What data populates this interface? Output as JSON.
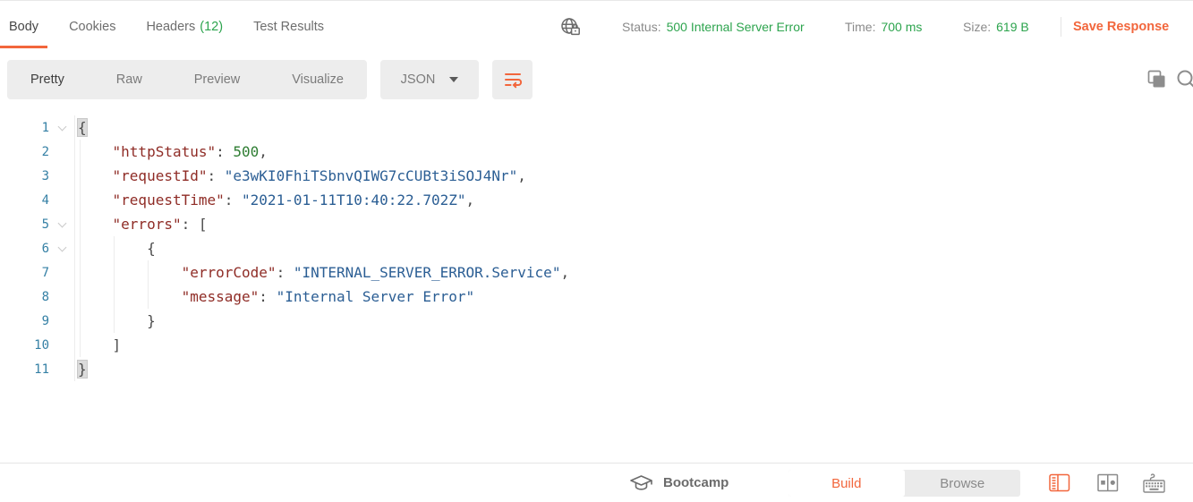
{
  "header": {
    "tabs": [
      {
        "label": "Body",
        "active": true
      },
      {
        "label": "Cookies"
      },
      {
        "label": "Headers",
        "count": "(12)"
      },
      {
        "label": "Test Results"
      }
    ],
    "status_label": "Status:",
    "status_value": "500 Internal Server Error",
    "time_label": "Time:",
    "time_value": "700 ms",
    "size_label": "Size:",
    "size_value": "619 B",
    "save_label": "Save Response"
  },
  "view_bar": {
    "tabs": [
      "Pretty",
      "Raw",
      "Preview",
      "Visualize"
    ],
    "language": "JSON"
  },
  "code": {
    "lines": [
      {
        "n": "1",
        "fold": true,
        "ind": 0,
        "tok": [
          {
            "t": "{",
            "c": "p hl"
          }
        ]
      },
      {
        "n": "2",
        "fold": false,
        "ind": 1,
        "tok": [
          {
            "t": "\"httpStatus\"",
            "c": "k"
          },
          {
            "t": ": ",
            "c": "p"
          },
          {
            "t": "500",
            "c": "n"
          },
          {
            "t": ",",
            "c": "p"
          }
        ]
      },
      {
        "n": "3",
        "fold": false,
        "ind": 1,
        "tok": [
          {
            "t": "\"requestId\"",
            "c": "k"
          },
          {
            "t": ": ",
            "c": "p"
          },
          {
            "t": "\"e3wKI0FhiTSbnvQIWG7cCUBt3iSOJ4Nr\"",
            "c": "s"
          },
          {
            "t": ",",
            "c": "p"
          }
        ]
      },
      {
        "n": "4",
        "fold": false,
        "ind": 1,
        "tok": [
          {
            "t": "\"requestTime\"",
            "c": "k"
          },
          {
            "t": ": ",
            "c": "p"
          },
          {
            "t": "\"2021-01-11T10:40:22.702Z\"",
            "c": "s"
          },
          {
            "t": ",",
            "c": "p"
          }
        ]
      },
      {
        "n": "5",
        "fold": true,
        "ind": 1,
        "tok": [
          {
            "t": "\"errors\"",
            "c": "k"
          },
          {
            "t": ": ",
            "c": "p"
          },
          {
            "t": "[",
            "c": "p"
          }
        ]
      },
      {
        "n": "6",
        "fold": true,
        "ind": 2,
        "tok": [
          {
            "t": "{",
            "c": "p"
          }
        ]
      },
      {
        "n": "7",
        "fold": false,
        "ind": 3,
        "tok": [
          {
            "t": "\"errorCode\"",
            "c": "k"
          },
          {
            "t": ": ",
            "c": "p"
          },
          {
            "t": "\"INTERNAL_SERVER_ERROR.Service\"",
            "c": "s"
          },
          {
            "t": ",",
            "c": "p"
          }
        ]
      },
      {
        "n": "8",
        "fold": false,
        "ind": 3,
        "tok": [
          {
            "t": "\"message\"",
            "c": "k"
          },
          {
            "t": ": ",
            "c": "p"
          },
          {
            "t": "\"Internal Server Error\"",
            "c": "s"
          }
        ]
      },
      {
        "n": "9",
        "fold": false,
        "ind": 2,
        "tok": [
          {
            "t": "}",
            "c": "p"
          }
        ]
      },
      {
        "n": "10",
        "fold": false,
        "ind": 1,
        "tok": [
          {
            "t": "]",
            "c": "p"
          }
        ]
      },
      {
        "n": "11",
        "fold": false,
        "ind": 0,
        "tok": [
          {
            "t": "}",
            "c": "p hl"
          }
        ]
      }
    ]
  },
  "footer": {
    "bootcamp_label": "Bootcamp",
    "build_label": "Build",
    "browse_label": "Browse"
  },
  "icons": {
    "globe_lock": "globe-lock-icon",
    "wrap": "wrap-text-icon",
    "copy": "copy-icon",
    "search": "search-icon",
    "caret": "caret-down-icon",
    "fold": "fold-chevron-icon",
    "graduation_cap": "graduation-cap-icon",
    "layout_single": "layout-single-pane-icon",
    "layout_two": "layout-two-pane-icon",
    "keyboard": "keyboard-shortcuts-icon"
  },
  "colors": {
    "accent_orange": "#F2663C",
    "success_green": "#2DA44E",
    "key_maroon": "#8F2C26",
    "string_blue": "#2B5E94",
    "number_green": "#2E7D32",
    "line_number_blue": "#3580A5"
  }
}
